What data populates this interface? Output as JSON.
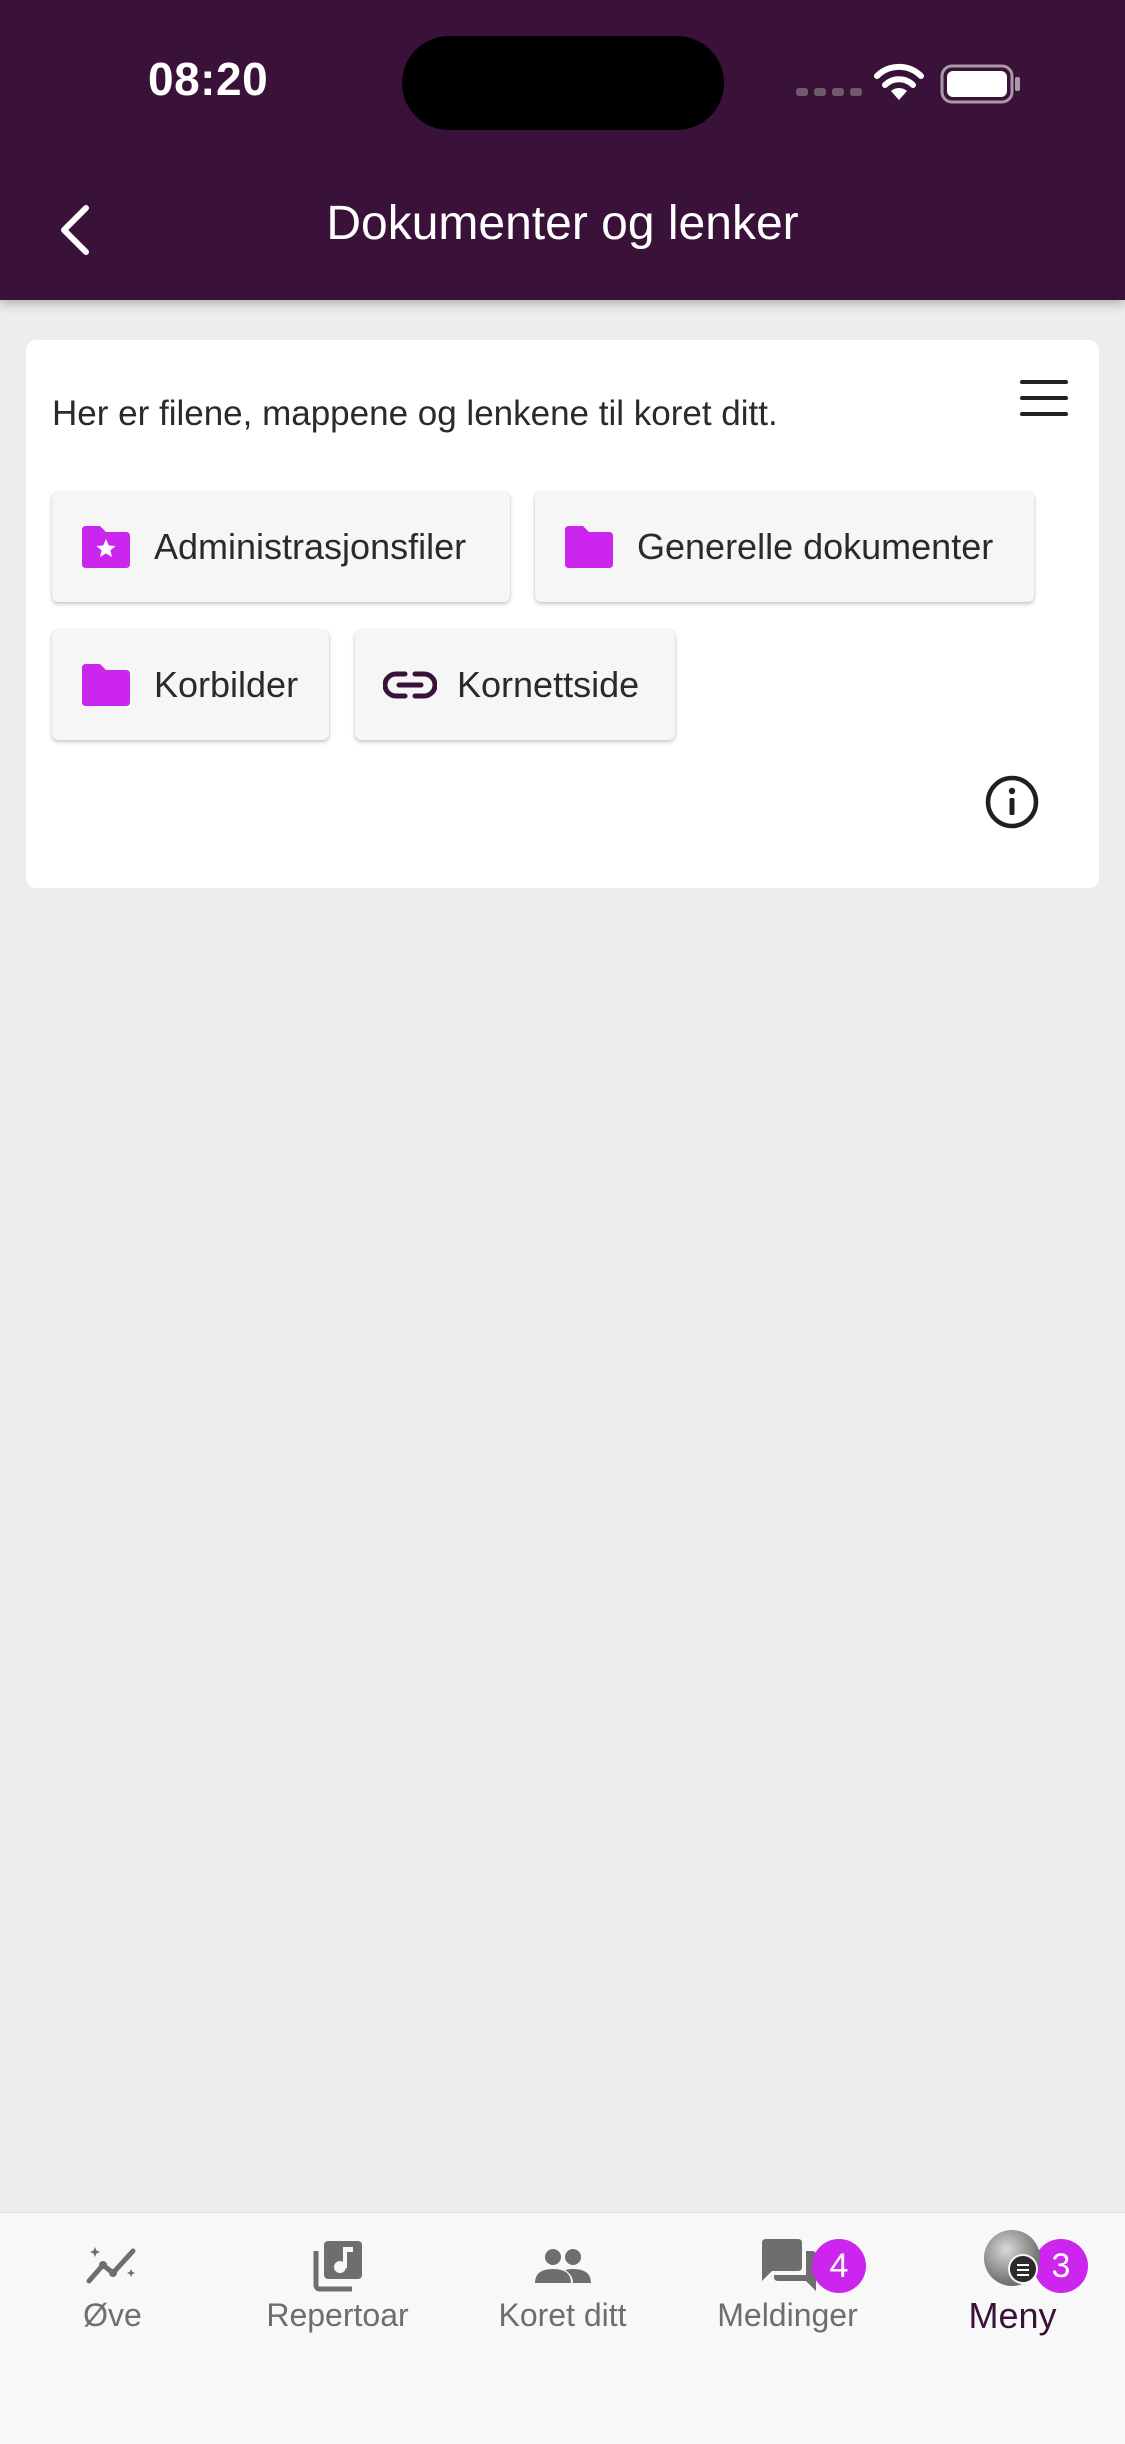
{
  "status_bar": {
    "time": "08:20"
  },
  "header": {
    "title": "Dokumenter og lenker"
  },
  "card": {
    "intro": "Her er filene, mappene og lenkene til koret ditt.",
    "items": [
      {
        "label": "Administrasjonsfiler",
        "icon": "folder-star-icon"
      },
      {
        "label": "Generelle dokumenter",
        "icon": "folder-icon"
      },
      {
        "label": "Korbilder",
        "icon": "folder-icon"
      },
      {
        "label": "Kornettside",
        "icon": "link-icon"
      }
    ]
  },
  "bottom_nav": {
    "items": [
      {
        "label": "Øve",
        "icon": "practice-trend-icon"
      },
      {
        "label": "Repertoar",
        "icon": "music-library-icon"
      },
      {
        "label": "Koret ditt",
        "icon": "people-icon"
      },
      {
        "label": "Meldinger",
        "icon": "chat-icon",
        "badge": "4"
      },
      {
        "label": "Meny",
        "icon": "avatar-menu-icon",
        "badge": "3",
        "active": true
      }
    ]
  },
  "colors": {
    "header_bg": "#3a1138",
    "accent_folder": "#cc26ee",
    "badge": "#cc26ee",
    "page_bg": "#ededed"
  }
}
